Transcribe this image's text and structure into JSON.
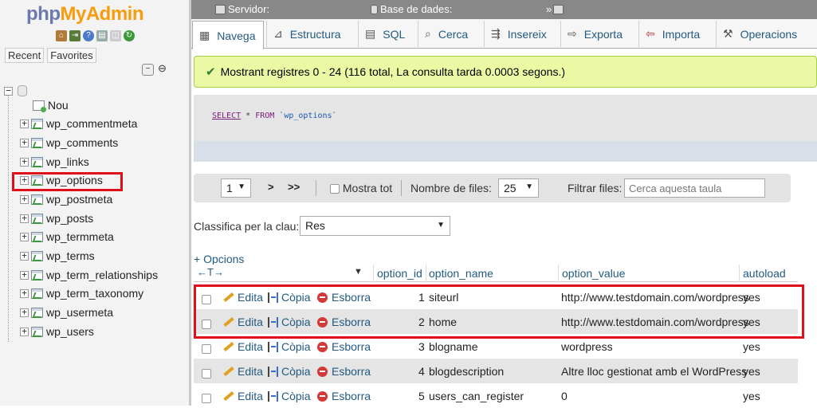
{
  "app": {
    "logo_a": "php",
    "logo_b": "MyAdmin"
  },
  "left": {
    "tabs": [
      "Recent",
      "Favorites"
    ],
    "tree": [
      "Nou",
      "wp_commentmeta",
      "wp_comments",
      "wp_links",
      "wp_options",
      "wp_postmeta",
      "wp_posts",
      "wp_termmeta",
      "wp_terms",
      "wp_term_relationships",
      "wp_term_taxonomy",
      "wp_usermeta",
      "wp_users"
    ],
    "highlighted_item": "wp_options"
  },
  "topbar": {
    "server_label": "Servidor:",
    "db_label": "Base de dades:",
    "arrow": "»"
  },
  "menu": {
    "tabs": [
      "Navega",
      "Estructura",
      "SQL",
      "Cerca",
      "Insereix",
      "Exporta",
      "Importa",
      "Operacions"
    ],
    "active": "Navega"
  },
  "success": {
    "message": "Mostrant registres 0 - 24 (116 total, La consulta tarda 0.0003 segons.)"
  },
  "sql": {
    "select": "SELECT",
    "star": " * ",
    "from": "FROM",
    "table": " `wp_options`"
  },
  "nav": {
    "page": "1",
    "next": ">",
    "last": ">>",
    "show_all": "Mostra tot",
    "rows_label": "Nombre de files:",
    "rows_value": "25",
    "filter_label": "Filtrar files:",
    "filter_placeholder": "Cerca aquesta taula"
  },
  "sort": {
    "label": "Classifica per la clau:",
    "value": "Res"
  },
  "options_link": "+ Opcions",
  "table": {
    "headers": [
      "option_id",
      "option_name",
      "option_value",
      "autoload"
    ],
    "actions": {
      "edit": "Edita",
      "copy": "Còpia",
      "delete": "Esborra"
    },
    "rows": [
      {
        "id": "1",
        "name": "siteurl",
        "value": "http://www.testdomain.com/wordpress",
        "autoload": "yes"
      },
      {
        "id": "2",
        "name": "home",
        "value": "http://www.testdomain.com/wordpress",
        "autoload": "yes"
      },
      {
        "id": "3",
        "name": "blogname",
        "value": "wordpress",
        "autoload": "yes"
      },
      {
        "id": "4",
        "name": "blogdescription",
        "value": "Altre lloc gestionat amb el WordPress",
        "autoload": "yes"
      },
      {
        "id": "5",
        "name": "users_can_register",
        "value": "0",
        "autoload": "yes"
      }
    ]
  }
}
